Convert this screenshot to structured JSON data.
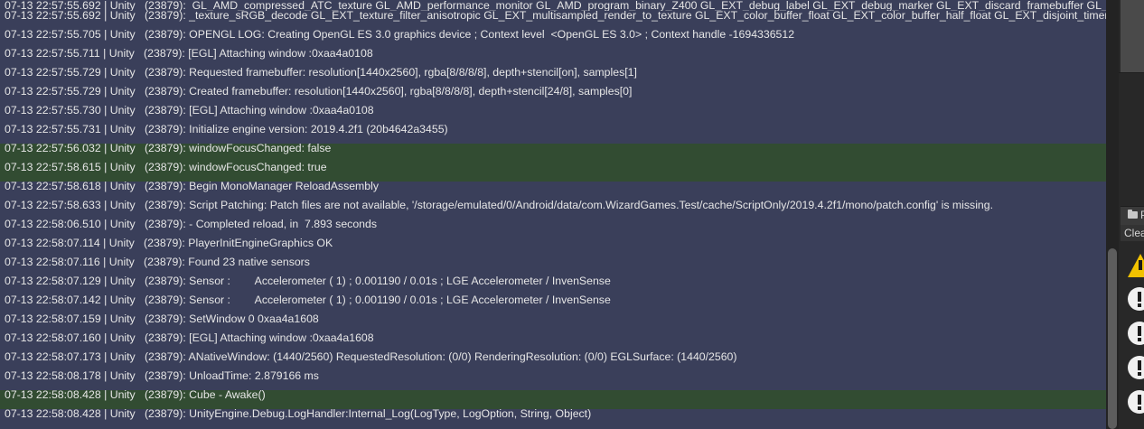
{
  "log": {
    "rows": [
      {
        "text": "07-13 22:57:55.692 | Unity   (23879):  GL_AMD_compressed_ATC_texture GL_AMD_performance_monitor GL_AMD_program_binary_Z400 GL_EXT_debug_label GL_EXT_debug_marker GL_EXT_discard_framebuffer GL_EXT",
        "highlight": false
      },
      {
        "text": "07-13 22:57:55.692 | Unity   (23879): _texture_sRGB_decode GL_EXT_texture_filter_anisotropic GL_EXT_multisampled_render_to_texture GL_EXT_color_buffer_float GL_EXT_color_buffer_half_float GL_EXT_disjoint_timer_que",
        "highlight": false
      },
      {
        "text": "07-13 22:57:55.705 | Unity   (23879): OPENGL LOG: Creating OpenGL ES 3.0 graphics device ; Context level  <OpenGL ES 3.0> ; Context handle -1694336512",
        "highlight": false
      },
      {
        "text": "07-13 22:57:55.711 | Unity   (23879): [EGL] Attaching window :0xaa4a0108",
        "highlight": false
      },
      {
        "text": "07-13 22:57:55.729 | Unity   (23879): Requested framebuffer: resolution[1440x2560], rgba[8/8/8/8], depth+stencil[on], samples[1]",
        "highlight": false
      },
      {
        "text": "07-13 22:57:55.729 | Unity   (23879): Created framebuffer: resolution[1440x2560], rgba[8/8/8/8], depth+stencil[24/8], samples[0]",
        "highlight": false
      },
      {
        "text": "07-13 22:57:55.730 | Unity   (23879): [EGL] Attaching window :0xaa4a0108",
        "highlight": false
      },
      {
        "text": "07-13 22:57:55.731 | Unity   (23879): Initialize engine version: 2019.4.2f1 (20b4642a3455)",
        "highlight": false
      },
      {
        "text": "07-13 22:57:56.032 | Unity   (23879): windowFocusChanged: false",
        "highlight": true
      },
      {
        "text": "07-13 22:57:58.615 | Unity   (23879): windowFocusChanged: true",
        "highlight": true
      },
      {
        "text": "07-13 22:57:58.618 | Unity   (23879): Begin MonoManager ReloadAssembly",
        "highlight": false
      },
      {
        "text": "07-13 22:57:58.633 | Unity   (23879): Script Patching: Patch files are not available, '/storage/emulated/0/Android/data/com.WizardGames.Test/cache/ScriptOnly/2019.4.2f1/mono/patch.config' is missing.",
        "highlight": false
      },
      {
        "text": "07-13 22:58:06.510 | Unity   (23879): - Completed reload, in  7.893 seconds",
        "highlight": false
      },
      {
        "text": "07-13 22:58:07.114 | Unity   (23879): PlayerInitEngineGraphics OK",
        "highlight": false
      },
      {
        "text": "07-13 22:58:07.116 | Unity   (23879): Found 23 native sensors",
        "highlight": false
      },
      {
        "text": "07-13 22:58:07.129 | Unity   (23879): Sensor :        Accelerometer ( 1) ; 0.001190 / 0.01s ; LGE Accelerometer / InvenSense",
        "highlight": false
      },
      {
        "text": "07-13 22:58:07.142 | Unity   (23879): Sensor :        Accelerometer ( 1) ; 0.001190 / 0.01s ; LGE Accelerometer / InvenSense",
        "highlight": false
      },
      {
        "text": "07-13 22:58:07.159 | Unity   (23879): SetWindow 0 0xaa4a1608",
        "highlight": false
      },
      {
        "text": "07-13 22:58:07.160 | Unity   (23879): [EGL] Attaching window :0xaa4a1608",
        "highlight": false
      },
      {
        "text": "07-13 22:58:07.173 | Unity   (23879): ANativeWindow: (1440/2560) RequestedResolution: (0/0) RenderingResolution: (0/0) EGLSurface: (1440/2560)",
        "highlight": false
      },
      {
        "text": "07-13 22:58:08.178 | Unity   (23879): UnloadTime: 2.879166 ms",
        "highlight": false
      },
      {
        "text": "07-13 22:58:08.428 | Unity   (23879): Cube - Awake()",
        "highlight": true
      },
      {
        "text": "07-13 22:58:08.428 | Unity   (23879): UnityEngine.Debug.LogHandler:Internal_Log(LogType, LogOption, String, Object)",
        "highlight": false
      }
    ]
  },
  "side": {
    "tab_label": "P",
    "clear_label": "Clea",
    "icons": [
      {
        "name": "warning-icon"
      },
      {
        "name": "error-icon"
      },
      {
        "name": "error-icon"
      },
      {
        "name": "error-icon"
      },
      {
        "name": "error-icon"
      }
    ]
  },
  "colors": {
    "log_bg": "#3a3f5a",
    "log_highlight": "#324c32",
    "text": "#e6e6e6",
    "warning": "#f2c200"
  }
}
